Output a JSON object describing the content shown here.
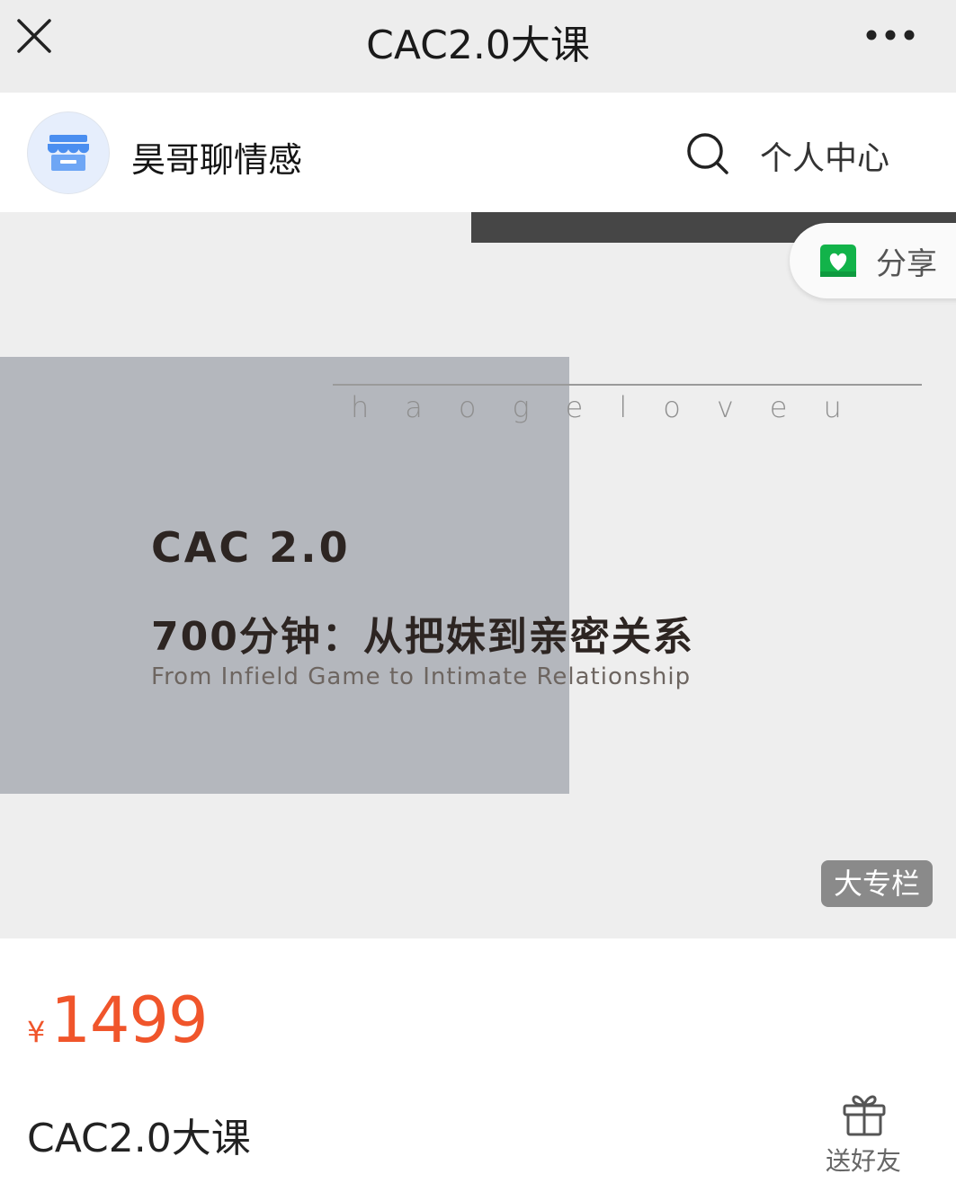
{
  "topbar": {
    "title": "CAC2.0大课",
    "close_icon": "close-icon",
    "more_icon": "more-horizontal-icon"
  },
  "shop": {
    "name": "昊哥聊情感",
    "avatar_icon": "storefront-icon",
    "search_icon": "search-icon",
    "profile_label": "个人中心"
  },
  "cover": {
    "brand": "haogeloveu",
    "title": "CAC 2.0",
    "subtitle": "700分钟：从把妹到亲密关系",
    "english": "From Infield Game to Intimate Relationship",
    "share_label": "分享",
    "share_icon": "wechat-favorite-icon",
    "badge": "大专栏"
  },
  "product": {
    "price_symbol": "¥",
    "price": "1499",
    "title": "CAC2.0大课",
    "gift_icon": "gift-icon",
    "gift_label": "送好友",
    "price_color": "#f0552b"
  }
}
